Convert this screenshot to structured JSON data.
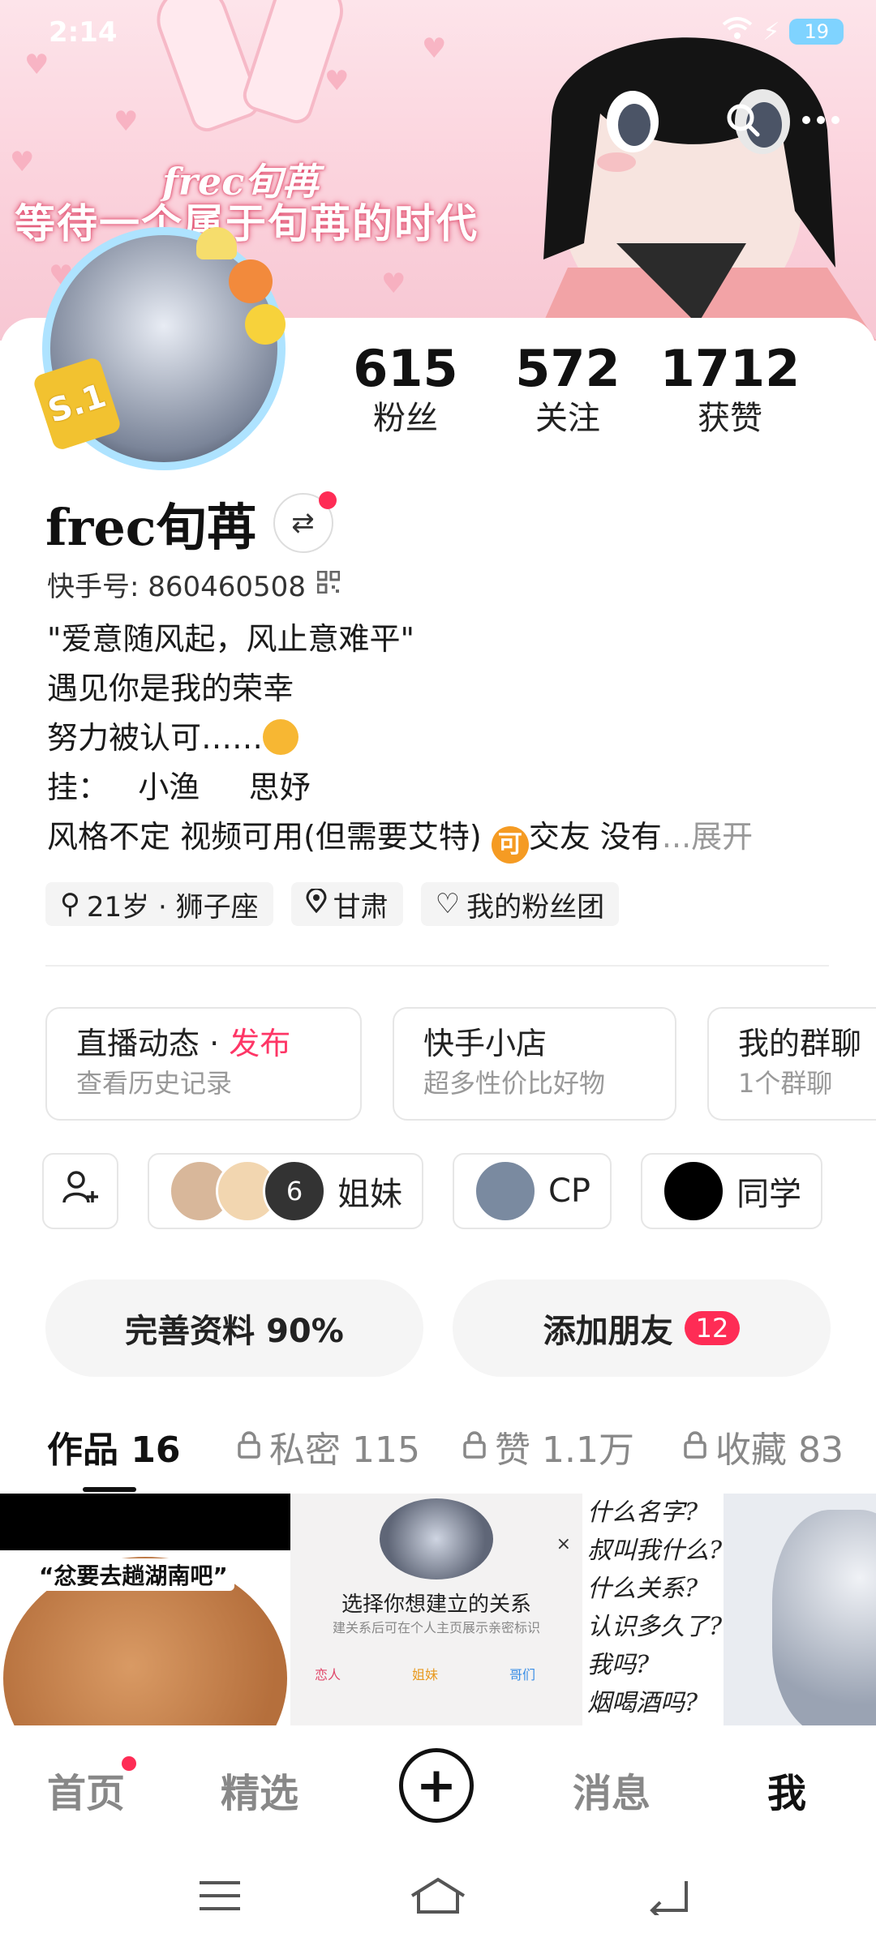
{
  "status_bar": {
    "time": "2:14",
    "battery": "19"
  },
  "banner": {
    "line1": "frec旬苒",
    "line2": "等待一个属于旬苒的时代"
  },
  "avatar": {
    "badge": "S.1"
  },
  "stats": [
    {
      "value": "615",
      "label": "粉丝"
    },
    {
      "value": "572",
      "label": "关注"
    },
    {
      "value": "1712",
      "label": "获赞"
    }
  ],
  "profile": {
    "username": "frec旬苒",
    "kuaishou_id": "快手号: 860460508",
    "bio": [
      "\"爱意随风起，风止意难平\"",
      "遇见你是我的荣幸",
      "努力被认可……",
      "挂：   小渔     思妤",
      "风格不定 视频可用(但需要艾特) "
    ],
    "bio_badge": "可",
    "bio_last_tail": "交友 没有",
    "expand_label": "...展开"
  },
  "tags": [
    {
      "icon": "gender-icon",
      "label": "21岁 · 狮子座"
    },
    {
      "icon": "location-icon",
      "label": "甘肃"
    },
    {
      "icon": "fan-club-icon",
      "label": "我的粉丝团"
    }
  ],
  "cards": [
    {
      "title": "直播动态",
      "title_accent": "发布",
      "sub": "查看历史记录"
    },
    {
      "title": "快手小店",
      "sub": "超多性价比好物"
    },
    {
      "title": "我的群聊",
      "sub": "1个群聊"
    }
  ],
  "groups": [
    {
      "label": "姐妹",
      "count_overlay": "6"
    },
    {
      "label": "CP"
    },
    {
      "label": "同学"
    }
  ],
  "actions": {
    "complete_profile": "完善资料 90%",
    "add_friends": "添加朋友",
    "add_friends_count": "12"
  },
  "tabs": [
    {
      "label": "作品 16",
      "locked": false,
      "active": true
    },
    {
      "label": "私密 115",
      "locked": true
    },
    {
      "label": "赞 1.1万",
      "locked": true
    },
    {
      "label": "收藏 83",
      "locked": true
    }
  ],
  "thumbnails": {
    "t1_caption": "“忿要去趟湖南吧”",
    "t2_caption": "选择你想建立的关系",
    "t2_sub": "建关系后可在个人主页展示亲密标识",
    "t2_options": [
      "恋人",
      "姐妹",
      "哥们"
    ],
    "t3_lines": [
      "什么名字?",
      "叔叫我什么?",
      "什么关系?",
      "认识多久了?",
      "我吗?",
      "烟喝酒吗?"
    ]
  },
  "bottom_nav": {
    "home": "首页",
    "featured": "精选",
    "messages": "消息",
    "me": "我"
  },
  "colors": {
    "accent": "#fe2c55",
    "banner": "#fbd2dc"
  }
}
